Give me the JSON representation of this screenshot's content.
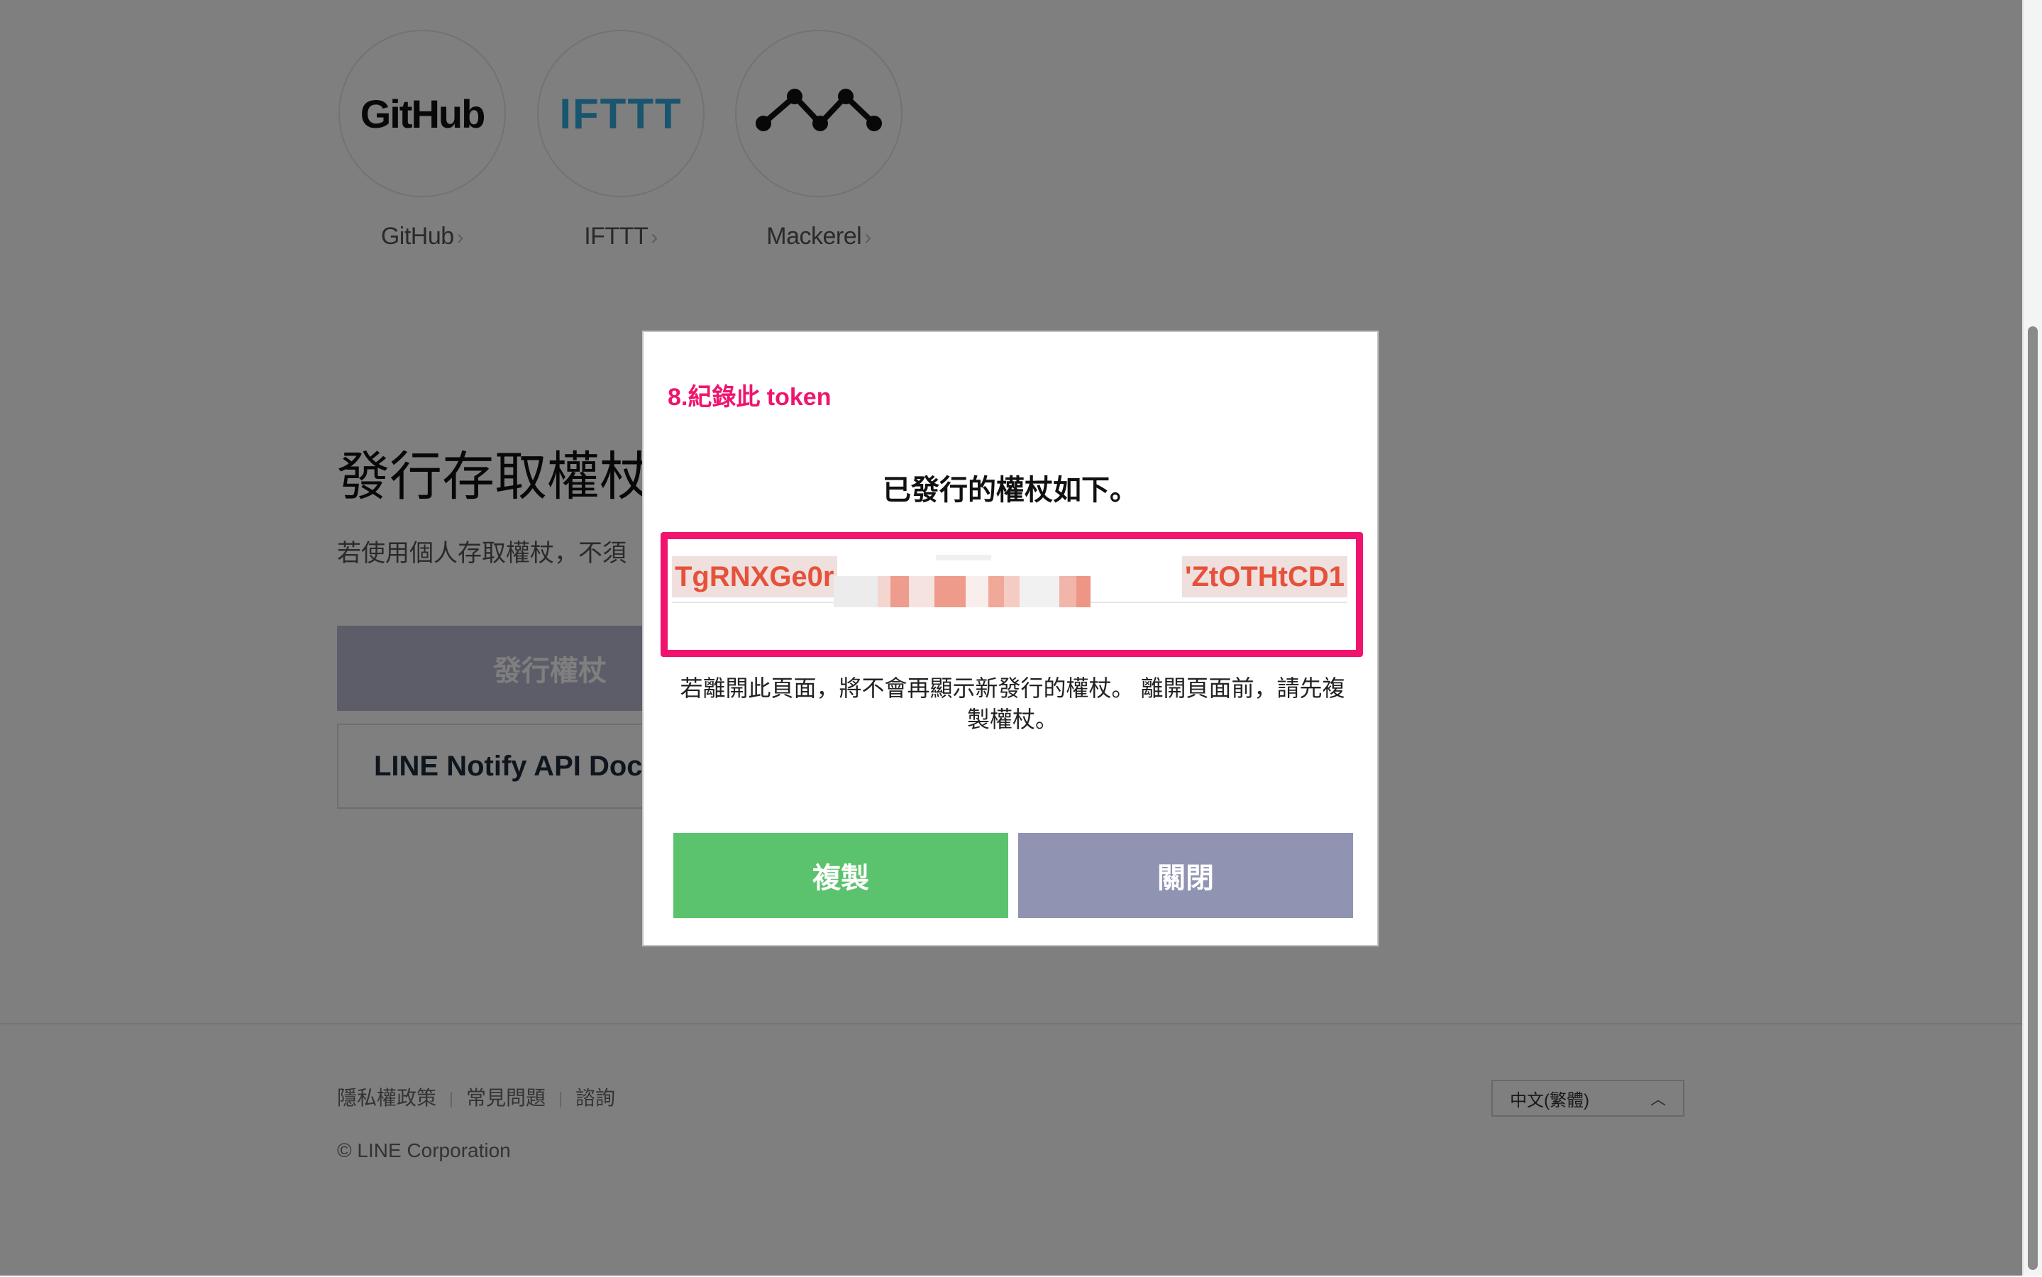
{
  "services": [
    {
      "logo": "GitHub",
      "label": "GitHub"
    },
    {
      "logo": "IFTTT",
      "label": "IFTTT"
    },
    {
      "logo": "mackerel-logo",
      "label": "Mackerel"
    }
  ],
  "issue_section": {
    "title": "發行存取權杖",
    "description": "若使用個人存取權杖，不須",
    "issue_button": "發行權杖",
    "docs_button": "LINE Notify API Doc"
  },
  "modal": {
    "annotation": "8.紀錄此 token",
    "title": "已發行的權杖如下。",
    "token_start": "TgRNXGe0r",
    "token_end": "'ZtOTHtCD1",
    "note": "若離開此頁面，將不會再顯示新發行的權杖。 離開頁面前，請先複製權杖。",
    "copy_button": "複製",
    "close_button": "關閉"
  },
  "footer": {
    "links": [
      "隱私權政策",
      "常見問題",
      "諮詢"
    ],
    "copyright": "© LINE Corporation",
    "language": "中文(繁體)"
  },
  "colors": {
    "accent_highlight": "#f0146e",
    "copy_green": "#5bc36d",
    "close_purple": "#9193b2",
    "token_red": "#e5513a"
  }
}
